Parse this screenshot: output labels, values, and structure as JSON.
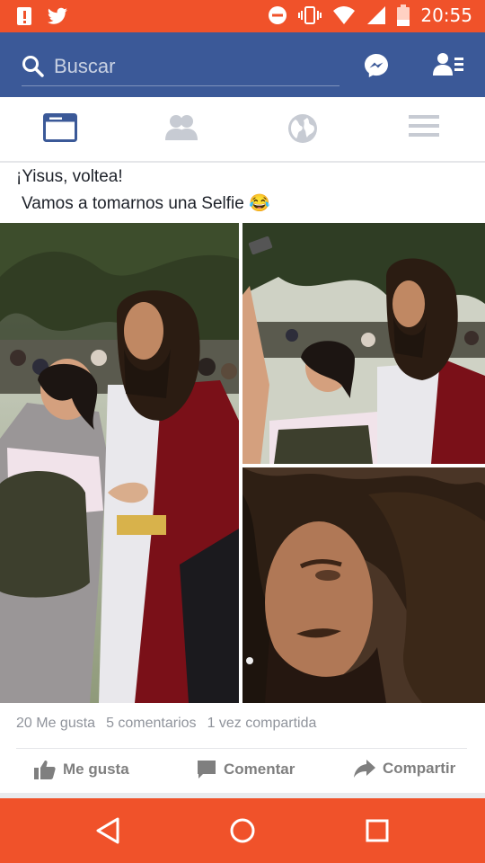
{
  "status_bar": {
    "time": "20:55",
    "icons": [
      "alert-icon",
      "twitter-icon",
      "do-not-disturb-icon",
      "vibrate-icon",
      "wifi-icon",
      "signal-icon",
      "battery-icon"
    ]
  },
  "app_bar": {
    "search_placeholder": "Buscar",
    "icons": [
      "search-icon",
      "messenger-icon",
      "friend-requests-icon"
    ],
    "color": "#3b5998"
  },
  "tabs": [
    {
      "name": "news-feed",
      "icon": "news-feed-icon",
      "active": true
    },
    {
      "name": "friends",
      "icon": "friends-icon",
      "active": false
    },
    {
      "name": "notifications",
      "icon": "globe-icon",
      "active": false
    },
    {
      "name": "menu",
      "icon": "menu-icon",
      "active": false
    }
  ],
  "post": {
    "caption_line1": "¡Yisus, voltea!",
    "caption_line2": "Vamos a tomarnos una Selfie 😂",
    "stats": {
      "likes": "20 Me gusta",
      "comments": "5 comentarios",
      "shares": "1 vez compartida"
    },
    "actions": {
      "like": "Me gusta",
      "comment": "Comentar",
      "share": "Compartir"
    }
  },
  "nav_bar": {
    "buttons": [
      "back-icon",
      "home-icon",
      "recents-icon"
    ],
    "color": "#f0522a"
  }
}
